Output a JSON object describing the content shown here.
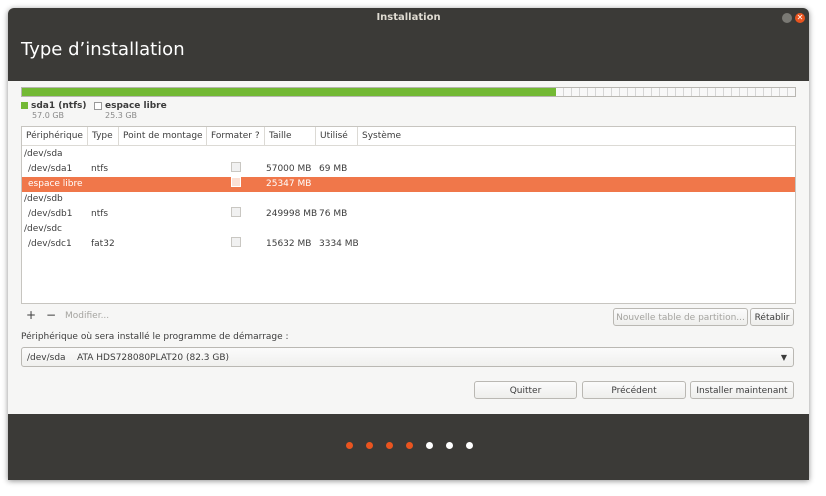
{
  "window": {
    "title": "Installation"
  },
  "header": {
    "title": "Type d’installation"
  },
  "partition_bar": {
    "used_fraction": 0.691,
    "colors": {
      "used": "#73b934",
      "free": "#d6d6d6"
    }
  },
  "legend": [
    {
      "name": "sda1 (ntfs)",
      "size": "57.0 GB",
      "color": "#73b934"
    },
    {
      "name": "espace libre",
      "size": "25.3 GB",
      "color": "#ffffff"
    }
  ],
  "table": {
    "columns": [
      "Périphérique",
      "Type",
      "Point de montage",
      "Formater ?",
      "Taille",
      "Utilisé",
      "Système"
    ],
    "rows": [
      {
        "device": "/dev/sda",
        "type": "",
        "mount": "",
        "format": false,
        "size": "",
        "used": "",
        "system": "",
        "group": true
      },
      {
        "device": "/dev/sda1",
        "type": "ntfs",
        "mount": "",
        "format": false,
        "size": "57000 MB",
        "used": "69 MB",
        "system": ""
      },
      {
        "device": "espace libre",
        "type": "",
        "mount": "",
        "format": false,
        "size": "25347 MB",
        "used": "",
        "system": "",
        "selected": true
      },
      {
        "device": "/dev/sdb",
        "type": "",
        "mount": "",
        "format": false,
        "size": "",
        "used": "",
        "system": "",
        "group": true
      },
      {
        "device": "/dev/sdb1",
        "type": "ntfs",
        "mount": "",
        "format": false,
        "size": "249998 MB",
        "used": "76 MB",
        "system": ""
      },
      {
        "device": "/dev/sdc",
        "type": "",
        "mount": "",
        "format": false,
        "size": "",
        "used": "",
        "system": "",
        "group": true
      },
      {
        "device": "/dev/sdc1",
        "type": "fat32",
        "mount": "",
        "format": false,
        "size": "15632 MB",
        "used": "3334 MB",
        "system": ""
      }
    ],
    "selection_color": "#f0774a"
  },
  "toolbar": {
    "add": "+",
    "remove": "−",
    "modify": "Modifier...",
    "new_table": "Nouvelle table de partition...",
    "revert": "Rétablir"
  },
  "bootloader": {
    "label": "Périphérique où sera installé le programme de démarrage :",
    "device": "/dev/sda",
    "description": "ATA HDS728080PLAT20 (82.3 GB)"
  },
  "buttons": {
    "quit": "Quitter",
    "back": "Précédent",
    "install": "Installer maintenant"
  },
  "progress": {
    "total": 7,
    "done": 4,
    "colors": {
      "done": "#e9541f",
      "todo": "#ffffff"
    }
  }
}
